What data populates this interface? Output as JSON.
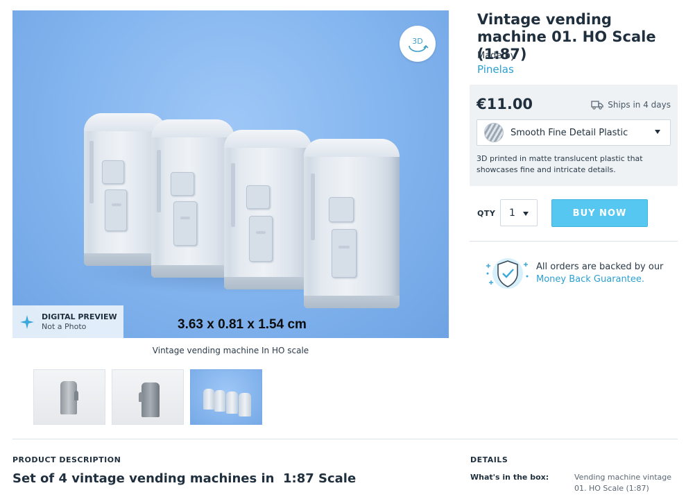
{
  "product": {
    "title": "Vintage vending machine 01. HO Scale (1:87)",
    "made_by_label": "Made by",
    "author": "Pinelas"
  },
  "preview": {
    "rotate_badge": "3D",
    "dimensions": "3.63 x 0.81 x 1.54 cm",
    "digital_preview_title": "DIGITAL PREVIEW",
    "digital_preview_sub": "Not a Photo",
    "caption": "Vintage vending machine In HO scale",
    "background_color": "#82b4ee"
  },
  "thumbnails": [
    {
      "name": "single-front",
      "active": false
    },
    {
      "name": "single-side",
      "active": false
    },
    {
      "name": "set-of-four",
      "active": true
    }
  ],
  "purchase": {
    "price": "€11.00",
    "ships": "Ships in 4 days",
    "material": "Smooth Fine Detail Plastic",
    "material_description": "3D printed in matte translucent plastic that showcases fine and intricate details.",
    "qty_label": "QTY",
    "qty_value": "1",
    "buy_label": "BUY NOW",
    "buy_color": "#55c7f1"
  },
  "guarantee": {
    "text": "All orders are backed by our",
    "link": "Money Back Guarantee."
  },
  "description": {
    "heading": "PRODUCT DESCRIPTION",
    "title": "Set of 4 vintage vending machines in  1:87 Scale"
  },
  "details": {
    "heading": "DETAILS",
    "box_label": "What's in the box:",
    "box_value": "Vending machine vintage 01. HO Scale (1:87)"
  }
}
